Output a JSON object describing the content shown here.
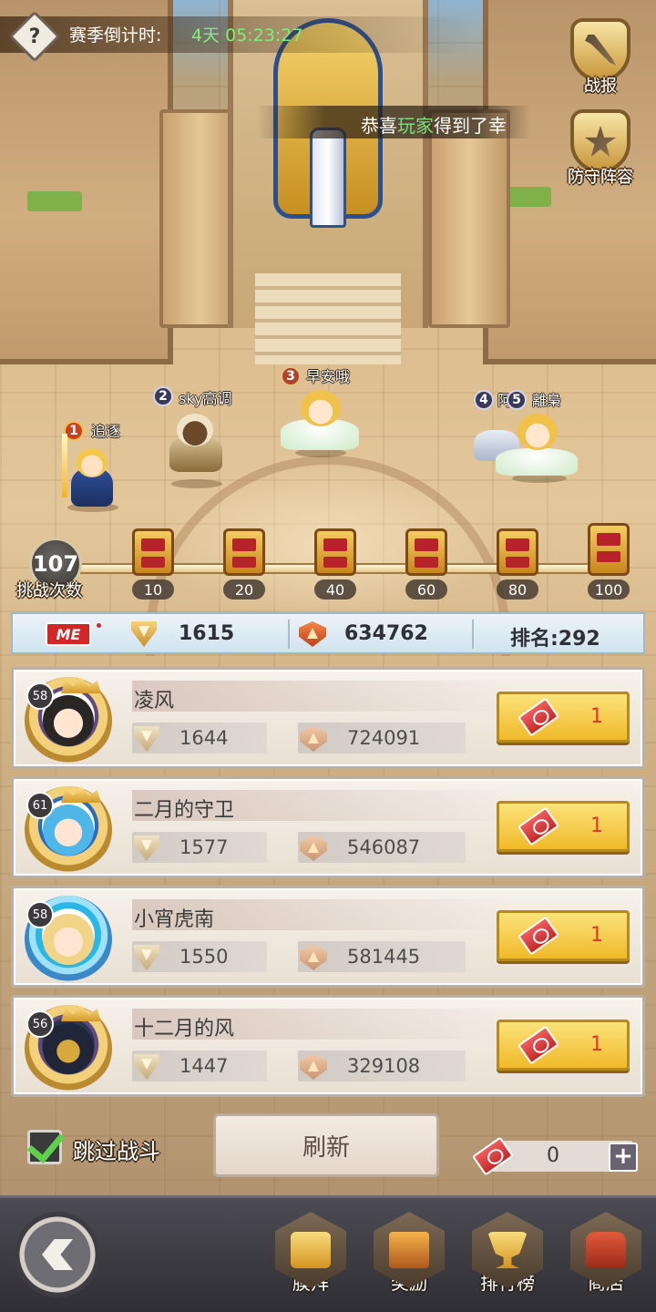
{
  "header": {
    "help_icon": "?",
    "season_label": "赛季倒计时:",
    "season_countdown": "4天 05:23:27",
    "ticker_prefix": "恭喜",
    "ticker_highlight": "玩家",
    "ticker_suffix": "得到了幸"
  },
  "side_buttons": [
    {
      "label": "战报",
      "icon": "crossed-swords-icon"
    },
    {
      "label": "防守阵容",
      "icon": "star-shield-icon"
    }
  ],
  "podium": [
    {
      "rank": "1",
      "name": "追逐"
    },
    {
      "rank": "2",
      "name": "sky高调"
    },
    {
      "rank": "3",
      "name": "早安哦"
    },
    {
      "rank": "4",
      "name": "阿"
    },
    {
      "rank": "5",
      "name": "離梟"
    }
  ],
  "progress": {
    "challenge_count": "107",
    "challenge_label": "挑战次数",
    "milestones": [
      "10",
      "20",
      "40",
      "60",
      "80",
      "100"
    ]
  },
  "my_stats": {
    "me_label": "ME",
    "trophies": "1615",
    "power": "634762",
    "rank": "排名:292"
  },
  "opponents": [
    {
      "level": "58",
      "name": "凌风",
      "trophies": "1644",
      "power": "724091",
      "cost": "1"
    },
    {
      "level": "61",
      "name": "二月的守卫",
      "trophies": "1577",
      "power": "546087",
      "cost": "1"
    },
    {
      "level": "58",
      "name": "小宵虎南",
      "trophies": "1550",
      "power": "581445",
      "cost": "1"
    },
    {
      "level": "56",
      "name": "十二月的风",
      "trophies": "1447",
      "power": "329108",
      "cost": "1"
    }
  ],
  "controls": {
    "skip_label": "跳过战斗",
    "refresh_label": "刷新",
    "ticket_count": "0",
    "plus_label": "+"
  },
  "nav": [
    {
      "label": "膜拜",
      "icon": "throne-icon"
    },
    {
      "label": "奖励",
      "icon": "mystery-box-icon"
    },
    {
      "label": "排行榜",
      "icon": "trophy-cup-icon"
    },
    {
      "label": "商店",
      "icon": "shop-chest-icon"
    }
  ],
  "colors": {
    "countdown": "#7bf17a",
    "highlight": "#7be07a",
    "fight_button": "#f0b92a",
    "cost_text": "#d53a2a",
    "me_badge": "#d22727"
  }
}
